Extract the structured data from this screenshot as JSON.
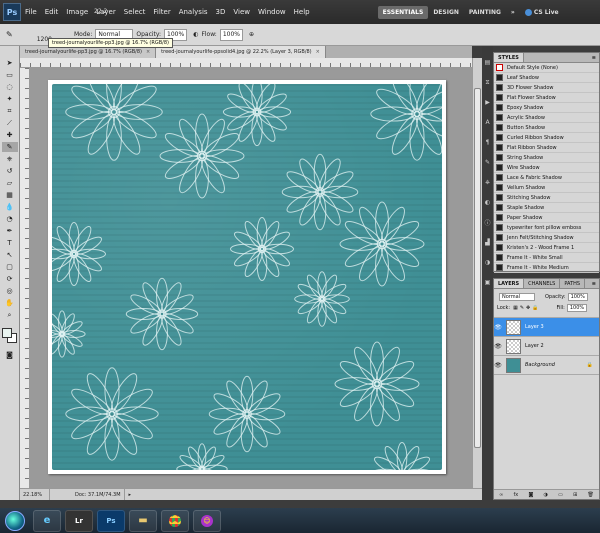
{
  "menubar": {
    "logo": "Ps",
    "items": [
      "File",
      "Edit",
      "Image",
      "Layer",
      "Select",
      "Filter",
      "Analysis",
      "3D",
      "View",
      "Window",
      "Help"
    ],
    "zoom": "22.2",
    "workspaces": [
      "ESSENTIALS",
      "DESIGN",
      "PAINTING"
    ],
    "more": "»",
    "cslive": "CS Live"
  },
  "optbar": {
    "brush_size": "1200",
    "mode_label": "Mode:",
    "mode_value": "Normal",
    "opacity_label": "Opacity:",
    "opacity_value": "100%",
    "flow_label": "Flow:",
    "flow_value": "100%"
  },
  "tooltip": "treed-journalyourlife-pp3.jpg @ 16.7% (RGB/8)",
  "tabs": [
    {
      "label": "treed-journalyourlife-pp3.jpg @ 16.7% (RGB/8)",
      "active": false
    },
    {
      "label": "treed-journalyourlife-ppsolid4.jpg @ 22.2% (Layer 3, RGB/8)",
      "active": true
    }
  ],
  "status": {
    "zoom": "22.18%",
    "doc": "Doc: 37.1M/74.3M"
  },
  "styles": {
    "tab": "STYLES",
    "items": [
      "Default Style (None)",
      "Leaf Shadow",
      "3D Flower Shadow",
      "Flat Flower Shadow",
      "Epoxy Shadow",
      "Acrylic Shadow",
      "Button Shadow",
      "Curled Ribbon Shadow",
      "Flat Ribbon Shadow",
      "String Shadow",
      "Wire Shadow",
      "Lace & Fabric Shadow",
      "Vellum Shadow",
      "Stitching Shadow",
      "Staple Shadow",
      "Paper Shadow",
      "typewriter font pillow emboss",
      "Jenn Felt/Stitching Shadow",
      "Kristen's 2 - Wood Frame 1",
      "Frame It - White Small",
      "Frame It - White Medium"
    ]
  },
  "layers": {
    "tabs": [
      "LAYERS",
      "CHANNELS",
      "PATHS"
    ],
    "blend_mode": "Normal",
    "opacity_label": "Opacity:",
    "opacity_value": "100%",
    "lock_label": "Lock:",
    "fill_label": "Fill:",
    "fill_value": "100%",
    "items": [
      {
        "name": "Layer 3",
        "selected": true
      },
      {
        "name": "Layer 2",
        "selected": false
      },
      {
        "name": "Background",
        "selected": false
      }
    ]
  },
  "taskbar": {
    "apps": [
      "ie-icon",
      "Lr",
      "Ps",
      "folder-icon",
      "chrome-icon",
      "messenger-icon"
    ]
  },
  "colors": {
    "paper": "#3f8f95",
    "selection": "#3b8fe8"
  }
}
